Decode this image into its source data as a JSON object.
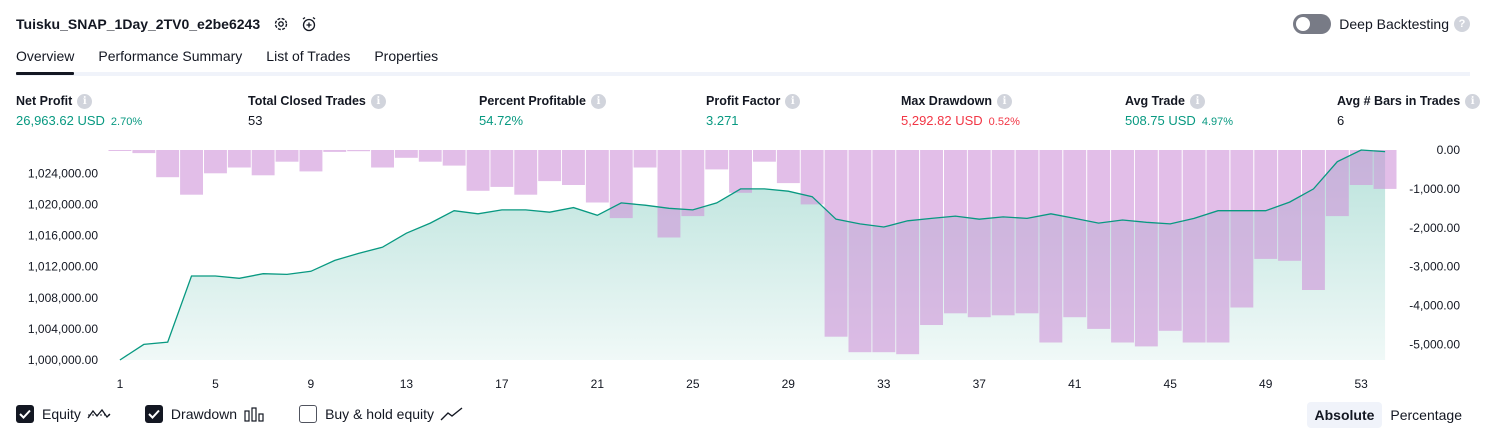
{
  "header": {
    "title": "Tuisku_SNAP_1Day_2TV0_e2be6243",
    "deep_backtesting_label": "Deep Backtesting",
    "help_glyph": "?"
  },
  "tabs": [
    {
      "label": "Overview",
      "active": true
    },
    {
      "label": "Performance Summary",
      "active": false
    },
    {
      "label": "List of Trades",
      "active": false
    },
    {
      "label": "Properties",
      "active": false
    }
  ],
  "metrics": [
    {
      "label": "Net Profit",
      "value": "26,963.62 USD",
      "pct": "2.70%",
      "color": "#089981"
    },
    {
      "label": "Total Closed Trades",
      "value": "53",
      "pct": "",
      "color": "#131722"
    },
    {
      "label": "Percent Profitable",
      "value": "54.72%",
      "pct": "",
      "color": "#089981"
    },
    {
      "label": "Profit Factor",
      "value": "3.271",
      "pct": "",
      "color": "#089981"
    },
    {
      "label": "Max Drawdown",
      "value": "5,292.82 USD",
      "pct": "0.52%",
      "color": "#f23645"
    },
    {
      "label": "Avg Trade",
      "value": "508.75 USD",
      "pct": "4.97%",
      "color": "#089981"
    },
    {
      "label": "Avg # Bars in Trades",
      "value": "6",
      "pct": "",
      "color": "#131722"
    }
  ],
  "info_glyph": "i",
  "chart_data": {
    "type": "area",
    "x_ticks": [
      "1",
      "5",
      "9",
      "13",
      "17",
      "21",
      "25",
      "29",
      "33",
      "37",
      "41",
      "45",
      "49",
      "53"
    ],
    "equity_axis": {
      "ticks": [
        "1,000,000.00",
        "1,004,000.00",
        "1,008,000.00",
        "1,012,000.00",
        "1,016,000.00",
        "1,020,000.00",
        "1,024,000.00"
      ],
      "tick_values": [
        1000000,
        1004000,
        1008000,
        1012000,
        1016000,
        1020000,
        1024000
      ],
      "range": [
        1000000,
        1027000
      ]
    },
    "drawdown_axis": {
      "ticks": [
        "0.00",
        "-1,000.00",
        "-2,000.00",
        "-3,000.00",
        "-4,000.00",
        "-5,000.00"
      ],
      "tick_values": [
        0,
        -1000,
        -2000,
        -3000,
        -4000,
        -5000
      ],
      "range": [
        -5400,
        0
      ]
    },
    "series": [
      {
        "name": "Equity",
        "color": "#089981",
        "x": [
          1,
          2,
          3,
          4,
          5,
          6,
          7,
          8,
          9,
          10,
          11,
          12,
          13,
          14,
          15,
          16,
          17,
          18,
          19,
          20,
          21,
          22,
          23,
          24,
          25,
          26,
          27,
          28,
          29,
          30,
          31,
          32,
          33,
          34,
          35,
          36,
          37,
          38,
          39,
          40,
          41,
          42,
          43,
          44,
          45,
          46,
          47,
          48,
          49,
          50,
          51,
          52,
          53,
          54
        ],
        "values": [
          1000000,
          1002000,
          1002300,
          1010800,
          1010800,
          1010500,
          1011100,
          1011000,
          1011400,
          1012800,
          1013700,
          1014500,
          1016300,
          1017600,
          1019200,
          1018800,
          1019300,
          1019300,
          1019000,
          1019600,
          1018600,
          1020200,
          1019900,
          1019500,
          1019300,
          1020200,
          1022000,
          1022000,
          1021700,
          1021000,
          1018100,
          1017500,
          1017100,
          1017900,
          1018200,
          1018500,
          1018100,
          1018400,
          1018200,
          1018800,
          1018200,
          1017600,
          1018000,
          1017700,
          1017500,
          1018200,
          1019200,
          1019200,
          1019200,
          1020300,
          1022000,
          1025500,
          1027000,
          1026800
        ]
      },
      {
        "name": "Drawdown",
        "color": "#b39ddb",
        "x": [
          1,
          2,
          3,
          4,
          5,
          6,
          7,
          8,
          9,
          10,
          11,
          12,
          13,
          14,
          15,
          16,
          17,
          18,
          19,
          20,
          21,
          22,
          23,
          24,
          25,
          26,
          27,
          28,
          29,
          30,
          31,
          32,
          33,
          34,
          35,
          36,
          37,
          38,
          39,
          40,
          41,
          42,
          43,
          44,
          45,
          46,
          47,
          48,
          49,
          50,
          51,
          52,
          53,
          54
        ],
        "values": [
          -20,
          -80,
          -700,
          -1150,
          -600,
          -450,
          -650,
          -300,
          -550,
          -50,
          -30,
          -450,
          -200,
          -300,
          -400,
          -1050,
          -950,
          -1150,
          -800,
          -900,
          -1350,
          -1750,
          -450,
          -2250,
          -1700,
          -500,
          -1100,
          -300,
          -850,
          -1400,
          -4800,
          -5200,
          -5200,
          -5250,
          -4500,
          -4200,
          -4300,
          -4250,
          -4200,
          -4950,
          -4300,
          -4600,
          -4950,
          -5050,
          -4650,
          -4950,
          -4950,
          -4050,
          -2800,
          -2850,
          -3600,
          -1700,
          -900,
          -1000
        ]
      }
    ],
    "grid": false
  },
  "legend": {
    "equity_label": "Equity",
    "drawdown_label": "Drawdown",
    "buyhold_label": "Buy & hold equity",
    "equity_checked": true,
    "drawdown_checked": true,
    "buyhold_checked": false
  },
  "mode": {
    "absolute_label": "Absolute",
    "percentage_label": "Percentage",
    "active": "Absolute"
  },
  "icons": {
    "settings": "gear-icon",
    "alert": "alarm-clock-plus-icon",
    "check": "checkmark-icon",
    "equity_legend": "line-chart-icon",
    "drawdown_legend": "bar-chart-icon",
    "buyhold_legend": "trend-line-icon"
  }
}
